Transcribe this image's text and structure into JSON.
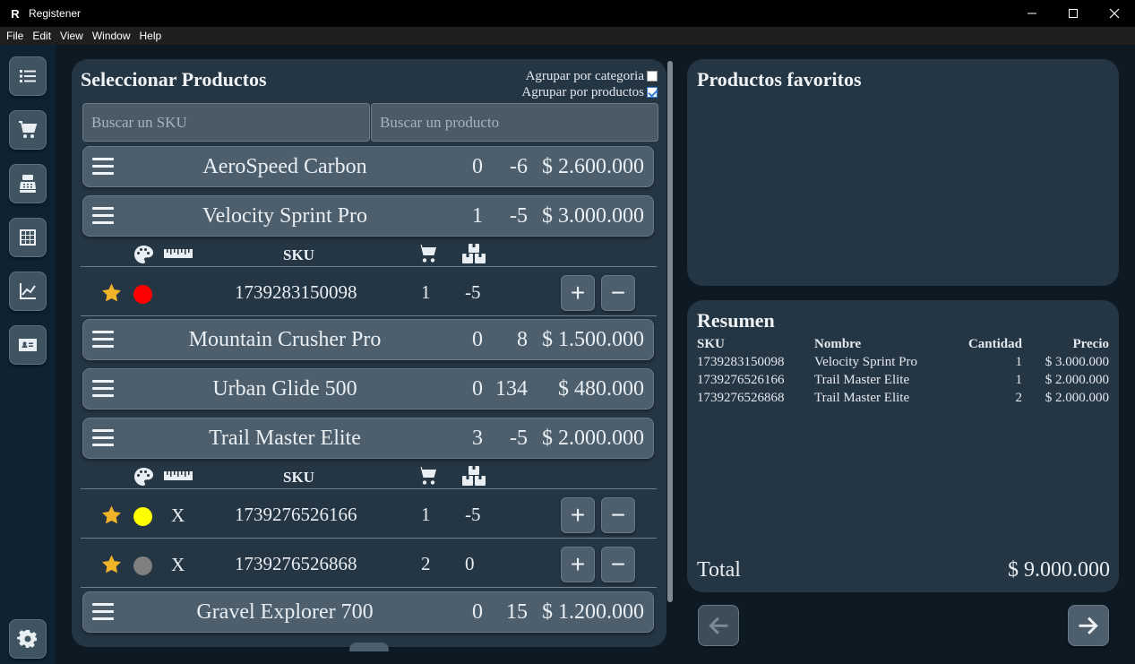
{
  "window": {
    "title": "Registener",
    "logo_letter": "R",
    "minimize_glyph": "—",
    "maximize_glyph": "☐",
    "close_glyph": "✕"
  },
  "menubar": [
    "File",
    "Edit",
    "View",
    "Window",
    "Help"
  ],
  "sidebar": {
    "items": [
      {
        "icon": "list-icon"
      },
      {
        "icon": "cart-icon"
      },
      {
        "icon": "cash-register-icon"
      },
      {
        "icon": "table-icon"
      },
      {
        "icon": "chart-icon"
      },
      {
        "icon": "id-card-icon"
      }
    ],
    "settings_icon": "gear-icon"
  },
  "products_panel": {
    "title": "Seleccionar Productos",
    "group_by_category_label": "Agrupar por categoria",
    "group_by_category_checked": false,
    "group_by_products_label": "Agrupar por productos",
    "group_by_products_checked": true,
    "sku_search_placeholder": "Buscar un SKU",
    "product_search_placeholder": "Buscar un producto",
    "variant_header_sku": "SKU",
    "plus_label": "+",
    "minus_label": "−",
    "products": [
      {
        "name": "AeroSpeed Carbon",
        "in_cart": "0",
        "stock": "-6",
        "price": "$ 2.600.000"
      },
      {
        "name": "Velocity Sprint Pro",
        "in_cart": "1",
        "stock": "-5",
        "price": "$ 3.000.000",
        "variants": [
          {
            "favorite": true,
            "color": "#ff0000",
            "size": "",
            "sku": "1739283150098",
            "qty": "1",
            "stock": "-5"
          }
        ]
      },
      {
        "name": "Mountain Crusher Pro",
        "in_cart": "0",
        "stock": "8",
        "price": "$ 1.500.000"
      },
      {
        "name": "Urban Glide 500",
        "in_cart": "0",
        "stock": "134",
        "price": "$ 480.000"
      },
      {
        "name": "Trail Master Elite",
        "in_cart": "3",
        "stock": "-5",
        "price": "$ 2.000.000",
        "variants": [
          {
            "favorite": true,
            "color": "#ffff00",
            "size": "X",
            "sku": "1739276526166",
            "qty": "1",
            "stock": "-5"
          },
          {
            "favorite": true,
            "color": "#808080",
            "size": "X",
            "sku": "1739276526868",
            "qty": "2",
            "stock": "0"
          }
        ]
      },
      {
        "name": "Gravel Explorer 700",
        "in_cart": "0",
        "stock": "15",
        "price": "$ 1.200.000"
      }
    ]
  },
  "favorites_panel": {
    "title": "Productos favoritos"
  },
  "summary_panel": {
    "title": "Resumen",
    "columns": [
      "SKU",
      "Nombre",
      "Cantidad",
      "Precio"
    ],
    "rows": [
      [
        "1739283150098",
        "Velocity Sprint Pro",
        "1",
        "$ 3.000.000"
      ],
      [
        "1739276526166",
        "Trail Master Elite",
        "1",
        "$ 2.000.000"
      ],
      [
        "1739276526868",
        "Trail Master Elite",
        "2",
        "$ 2.000.000"
      ]
    ],
    "total_label": "Total",
    "total_value": "$ 9.000.000"
  },
  "nav": {
    "back_icon": "arrow-left-icon",
    "next_icon": "arrow-right-icon"
  },
  "colors": {
    "panel": "#243543",
    "row": "#4d5f6d",
    "star": "#f0b429"
  }
}
